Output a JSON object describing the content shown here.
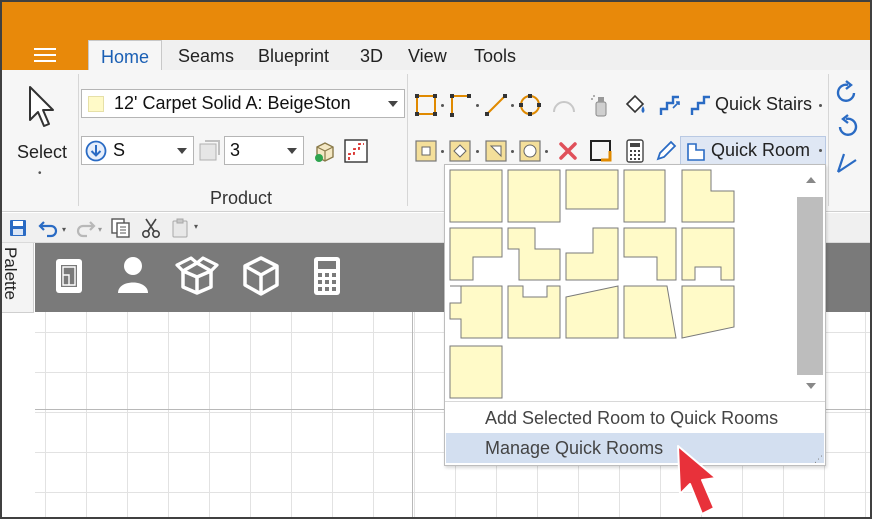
{
  "tabs": [
    {
      "label": "Home"
    },
    {
      "label": "Seams"
    },
    {
      "label": "Blueprint"
    },
    {
      "label": "3D"
    },
    {
      "label": "View"
    },
    {
      "label": "Tools"
    }
  ],
  "ribbon": {
    "select_label": "Select",
    "product_combo_value": "12' Carpet Solid A: BeigeSton",
    "direction_combo_value": "S",
    "count_combo_value": "3",
    "product_group_label": "Product",
    "quick_stairs_label": "Quick Stairs",
    "quick_room_label": "Quick Room"
  },
  "palette": {
    "tab_label": "Palette",
    "icons": [
      "blueprint-icon",
      "user-icon",
      "open-box-icon",
      "cube-icon",
      "calculator-icon"
    ]
  },
  "quick_rooms": {
    "menu_items": [
      {
        "label": "Add Selected Room to Quick Rooms"
      },
      {
        "label": "Manage Quick Rooms"
      }
    ]
  },
  "colors": {
    "title_bar": "#e8890a",
    "room_fill": "#fffac8",
    "highlight": "#d3dff0",
    "pointer_arrow": "#e8313a"
  }
}
